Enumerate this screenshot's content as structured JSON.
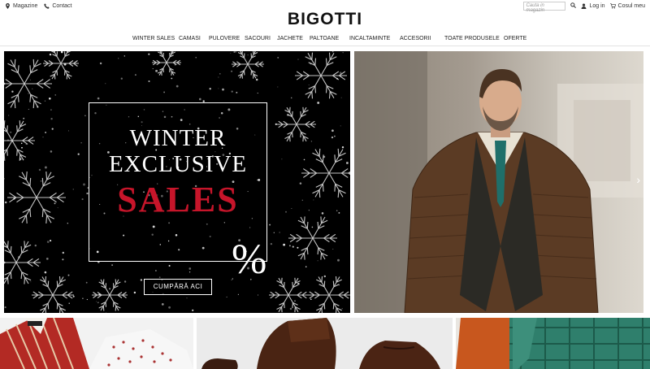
{
  "topbar": {
    "left_links": [
      {
        "label": "Magazine",
        "icon": "map-marker-icon"
      },
      {
        "label": "Contact",
        "icon": "phone-icon"
      }
    ],
    "logo": "BIGOTTI",
    "search_placeholder": "Cauta in magazin",
    "login_label": "Log in",
    "cart_label": "Cosul meu"
  },
  "nav": {
    "items": [
      "WINTER SALES",
      "CAMASI",
      "PULOVERE",
      "SACOURI",
      "JACHETE",
      "PALTOANE",
      "INCALTAMINTE",
      "ACCESORII",
      "TOATE PRODUSELE",
      "OFERTE"
    ]
  },
  "hero": {
    "line1": "WINTER",
    "line2": "EXCLUSIVE",
    "line3": "SALES",
    "percent": "%",
    "cta_label": "CUMPĂRĂ ACI",
    "accent_color": "#c6152a"
  },
  "tiles": [
    {
      "name": "shirts"
    },
    {
      "name": "shoes"
    },
    {
      "name": "jackets"
    }
  ]
}
